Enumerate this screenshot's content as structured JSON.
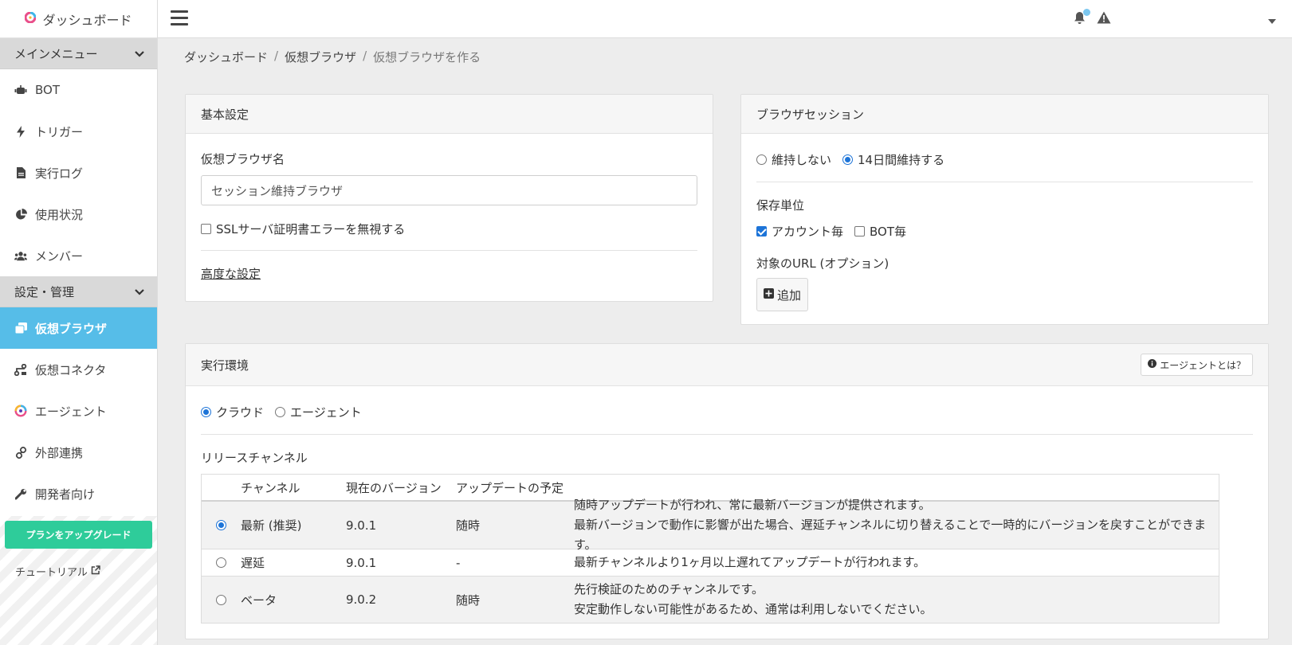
{
  "brand": {
    "name": "ダッシュボード"
  },
  "sidebar": {
    "sections": [
      {
        "label": "メインメニュー",
        "items": [
          {
            "label": "BOT",
            "icon": "robot-icon"
          },
          {
            "label": "トリガー",
            "icon": "bolt-icon"
          },
          {
            "label": "実行ログ",
            "icon": "file-icon"
          },
          {
            "label": "使用状況",
            "icon": "pie-chart-icon"
          },
          {
            "label": "メンバー",
            "icon": "users-icon"
          }
        ]
      },
      {
        "label": "設定・管理",
        "items": [
          {
            "label": "仮想ブラウザ",
            "icon": "browser-copy-icon",
            "active": true
          },
          {
            "label": "仮想コネクタ",
            "icon": "connector-icon"
          },
          {
            "label": "エージェント",
            "icon": "agent-icon"
          },
          {
            "label": "外部連携",
            "icon": "link-icon"
          },
          {
            "label": "開発者向け",
            "icon": "wrench-icon"
          }
        ]
      }
    ],
    "upgrade_label": "プランをアップグレード",
    "tutorial_label": "チュートリアル"
  },
  "breadcrumb": [
    "ダッシュボード",
    "仮想ブラウザ",
    "仮想ブラウザを作る"
  ],
  "basic": {
    "title": "基本設定",
    "name_label": "仮想ブラウザ名",
    "name_value": "セッション維持ブラウザ",
    "ssl_label": "SSLサーバ証明書エラーを無視する",
    "ssl_checked": false,
    "advanced_label": "高度な設定"
  },
  "session": {
    "title": "ブラウザセッション",
    "options": [
      "維持しない",
      "14日間維持する"
    ],
    "selected": 1,
    "unit_label": "保存単位",
    "units": [
      {
        "label": "アカウント毎",
        "checked": true
      },
      {
        "label": "BOT毎",
        "checked": false
      }
    ],
    "url_label": "対象のURL (オプション)",
    "add_label": "追加"
  },
  "runtime": {
    "title": "実行環境",
    "info_button": "エージェントとは？",
    "options": [
      "クラウド",
      "エージェント"
    ],
    "selected": 0,
    "channel_label": "リリースチャンネル",
    "columns": [
      "チャンネル",
      "現在のバージョン",
      "アップデートの予定"
    ],
    "rows": [
      {
        "channel": "最新 (推奨)",
        "version": "9.0.1",
        "schedule": "随時",
        "desc": [
          "随時アップデートが行われ、常に最新バージョンが提供されます。",
          "最新バージョンで動作に影響が出た場合、遅延チャンネルに切り替えることで一時的にバージョンを戻すことができます。"
        ],
        "selected": true
      },
      {
        "channel": "遅延",
        "version": "9.0.1",
        "schedule": "-",
        "desc": [
          "最新チャンネルより1ヶ月以上遅れてアップデートが行われます。"
        ],
        "selected": false
      },
      {
        "channel": "ベータ",
        "version": "9.0.2",
        "schedule": "随時",
        "desc": [
          "先行検証のためのチャンネルです。",
          "安定動作しない可能性があるため、通常は利用しないでください。"
        ],
        "selected": false
      }
    ]
  },
  "colors": {
    "accent": "#56bde8",
    "upgrade": "#2ecc9a",
    "radio": "#1d74d8"
  }
}
